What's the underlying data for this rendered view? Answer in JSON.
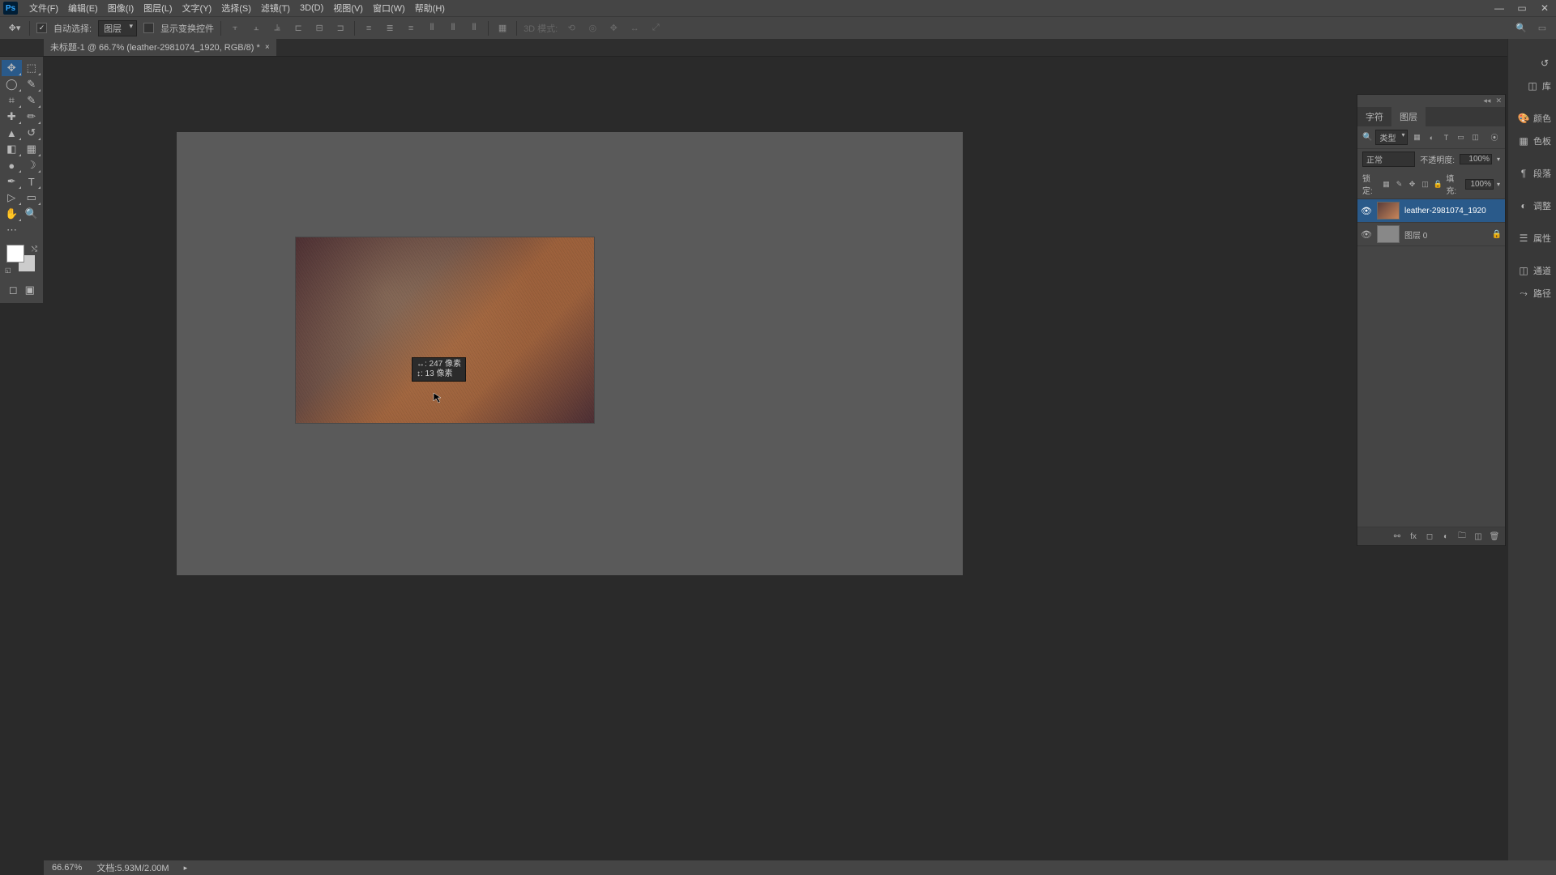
{
  "menu": {
    "items": [
      "文件(F)",
      "编辑(E)",
      "图像(I)",
      "图层(L)",
      "文字(Y)",
      "选择(S)",
      "滤镜(T)",
      "3D(D)",
      "视图(V)",
      "窗口(W)",
      "帮助(H)"
    ]
  },
  "window_controls": {
    "min": "—",
    "max": "▭",
    "close": "✕"
  },
  "options": {
    "auto_select_label": "自动选择:",
    "auto_select_value": "图层",
    "show_transform_label": "显示变换控件",
    "mode3d_label": "3D 模式:"
  },
  "doc_tab": {
    "title": "未标题-1 @ 66.7% (leather-2981074_1920, RGB/8) *"
  },
  "move_tooltip": {
    "line1": "↔: 247 像素",
    "line2": "↕: 13 像素"
  },
  "layers": {
    "tabs": [
      "字符",
      "图层"
    ],
    "filter_type_label": "类型",
    "blend_mode": "正常",
    "opacity_label": "不透明度:",
    "opacity_value": "100%",
    "lock_label": "锁定:",
    "fill_label": "填充:",
    "fill_value": "100%",
    "items": [
      {
        "name": "leather-2981074_1920",
        "visible": true,
        "selected": true,
        "locked": false,
        "thumb": "img"
      },
      {
        "name": "图层 0",
        "visible": true,
        "selected": false,
        "locked": true,
        "thumb": "blank"
      }
    ]
  },
  "dock": {
    "items1": [
      "库",
      "颜色",
      "色板",
      "段落",
      "调整",
      "属性",
      "通道",
      "路径"
    ],
    "labels": {
      "lib": "库",
      "color": "颜色",
      "swatch": "色板",
      "para": "段落",
      "adjust": "调整",
      "prop": "属性",
      "channel": "通道",
      "path": "路径"
    }
  },
  "status": {
    "zoom": "66.67%",
    "doc_label": "文档:",
    "doc_value": "5.93M/2.00M"
  }
}
